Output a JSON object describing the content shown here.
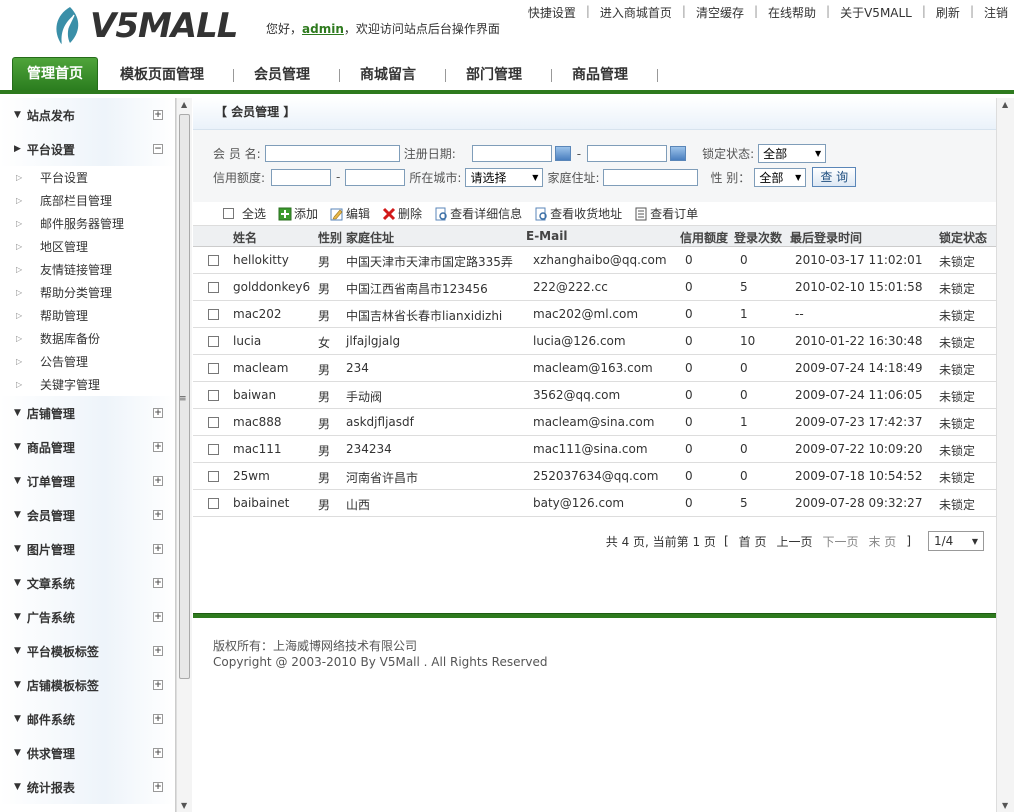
{
  "brand": {
    "logo_text": "V5MALL"
  },
  "welcome": {
    "prefix": "您好，",
    "user": "admin",
    "suffix": "，欢迎访问站点后台操作界面"
  },
  "top_links": [
    "快捷设置",
    "进入商城首页",
    "清空缓存",
    "在线帮助",
    "关于V5MALL",
    "刷新",
    "注销"
  ],
  "nav_tabs": [
    "管理首页",
    "模板页面管理",
    "会员管理",
    "商城留言",
    "部门管理",
    "商品管理"
  ],
  "sidebar": {
    "groups": [
      {
        "label": "站点发布",
        "toggle": "+"
      },
      {
        "label": "平台设置",
        "toggle": "−",
        "items": [
          "平台设置",
          "底部栏目管理",
          "邮件服务器管理",
          "地区管理",
          "友情链接管理",
          "帮助分类管理",
          "帮助管理",
          "数据库备份",
          "公告管理",
          "关键字管理"
        ]
      },
      {
        "label": "店铺管理",
        "toggle": "+"
      },
      {
        "label": "商品管理",
        "toggle": "+"
      },
      {
        "label": "订单管理",
        "toggle": "+"
      },
      {
        "label": "会员管理",
        "toggle": "+"
      },
      {
        "label": "图片管理",
        "toggle": "+"
      },
      {
        "label": "文章系统",
        "toggle": "+"
      },
      {
        "label": "广告系统",
        "toggle": "+"
      },
      {
        "label": "平台模板标签",
        "toggle": "+"
      },
      {
        "label": "店铺模板标签",
        "toggle": "+"
      },
      {
        "label": "邮件系统",
        "toggle": "+"
      },
      {
        "label": "供求管理",
        "toggle": "+"
      },
      {
        "label": "统计报表",
        "toggle": "+"
      }
    ]
  },
  "page": {
    "title": "【 会员管理 】"
  },
  "search": {
    "name_label": "会 员 名:",
    "reg_date_label": "注册日期:",
    "date_sep": "-",
    "lock_label": "锁定状态:",
    "lock_value": "全部",
    "credit_label": "信用额度:",
    "credit_sep": "-",
    "city_label": "所在城市:",
    "city_value": "请选择",
    "address_label": "家庭住址:",
    "gender_label": "性  别：",
    "gender_value": "全部",
    "query_button": "查 询"
  },
  "toolbar": {
    "select_all": "全选",
    "add": "添加",
    "edit": "编辑",
    "delete": "删除",
    "view_detail": "查看详细信息",
    "view_address": "查看收货地址",
    "view_orders": "查看订单"
  },
  "table": {
    "headers": [
      "姓名",
      "性别",
      "家庭住址",
      "E-Mail",
      "信用额度",
      "登录次数",
      "最后登录时间",
      "锁定状态"
    ],
    "rows": [
      [
        "hellokitty",
        "男",
        "中国天津市天津市国定路335弄",
        "xzhanghaibo@qq.com",
        "0",
        "0",
        "2010-03-17 11:02:01",
        "未锁定"
      ],
      [
        "golddonkey6",
        "男",
        "中国江西省南昌市123456",
        "222@222.cc",
        "0",
        "5",
        "2010-02-10 15:01:58",
        "未锁定"
      ],
      [
        "mac202",
        "男",
        "中国吉林省长春市lianxidizhi",
        "mac202@ml.com",
        "0",
        "1",
        "--",
        "未锁定"
      ],
      [
        "lucia",
        "女",
        "jlfajlgjalg",
        "lucia@126.com",
        "0",
        "10",
        "2010-01-22 16:30:48",
        "未锁定"
      ],
      [
        "macleam",
        "男",
        "234",
        "macleam@163.com",
        "0",
        "0",
        "2009-07-24 14:18:49",
        "未锁定"
      ],
      [
        "baiwan",
        "男",
        "手动阀",
        "3562@qq.com",
        "0",
        "0",
        "2009-07-24 11:06:05",
        "未锁定"
      ],
      [
        "mac888",
        "男",
        "askdjfljasdf",
        "macleam@sina.com",
        "0",
        "1",
        "2009-07-23 17:42:37",
        "未锁定"
      ],
      [
        "mac111",
        "男",
        "234234",
        "mac111@sina.com",
        "0",
        "0",
        "2009-07-22 10:09:20",
        "未锁定"
      ],
      [
        "25wm",
        "男",
        "河南省许昌市",
        "252037634@qq.com",
        "0",
        "0",
        "2009-07-18 10:54:52",
        "未锁定"
      ],
      [
        "baibainet",
        "男",
        "山西",
        "baty@126.com",
        "0",
        "5",
        "2009-07-28 09:32:27",
        "未锁定"
      ]
    ]
  },
  "pager": {
    "summary": "共 4 页, 当前第 1 页",
    "open": "[",
    "first": "首 页",
    "prev": "上一页",
    "next": "下一页",
    "last": "末 页",
    "close": "]",
    "page_select": "1/4"
  },
  "footer": {
    "owner": "版权所有：上海威博网络技术有限公司",
    "copyright": "Copyright @ 2003-2010 By V5Mall . All Rights Reserved"
  },
  "colors": {
    "accent_green": "#2e7a1e",
    "link_blue": "#1f4f80"
  }
}
